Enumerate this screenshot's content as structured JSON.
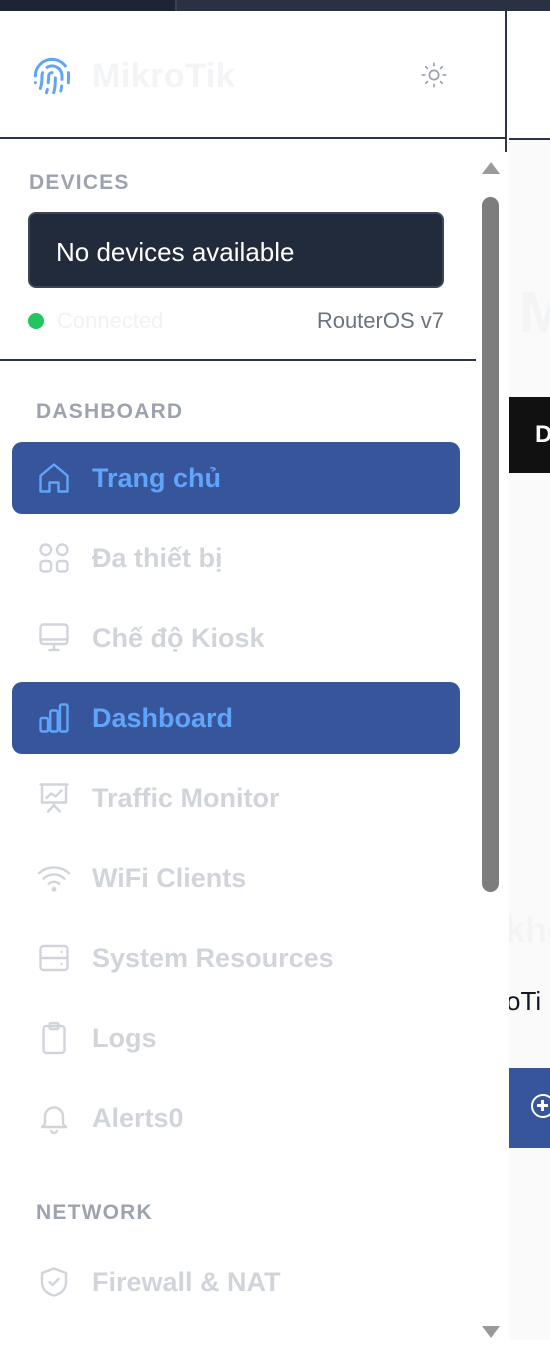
{
  "brand": {
    "name": "MikroTik"
  },
  "devices": {
    "title": "DEVICES",
    "select_value": "No devices available",
    "status": "Connected",
    "version": "RouterOS v7"
  },
  "nav": {
    "sections": [
      {
        "title": "DASHBOARD"
      },
      {
        "title": "NETWORK"
      }
    ],
    "items": [
      {
        "label": "Trang chủ",
        "icon": "home-icon",
        "active": true
      },
      {
        "label": "Đa thiết bị",
        "icon": "grid-icon",
        "active": false
      },
      {
        "label": "Chế độ Kiosk",
        "icon": "monitor-icon",
        "active": false
      },
      {
        "label": "Dashboard",
        "icon": "bar-chart-icon",
        "active": true
      },
      {
        "label": "Traffic Monitor",
        "icon": "presentation-chart-icon",
        "active": false
      },
      {
        "label": "WiFi Clients",
        "icon": "wifi-icon",
        "active": false
      },
      {
        "label": "System Resources",
        "icon": "server-icon",
        "active": false
      },
      {
        "label": "Logs",
        "icon": "clipboard-icon",
        "active": false
      },
      {
        "label": "Alerts0",
        "icon": "bell-icon",
        "active": false
      },
      {
        "label": "Firewall & NAT",
        "icon": "shield-icon",
        "active": false
      }
    ]
  },
  "main": {
    "heading_fragment": "M",
    "tab_fragment": "D",
    "subheading_fragment": "khó",
    "text_fragment": "oTi"
  },
  "colors": {
    "active_bg": "#36559b",
    "active_text": "#60a5fa",
    "status_dot": "#22c55e",
    "panel_dark": "#222b3b"
  }
}
